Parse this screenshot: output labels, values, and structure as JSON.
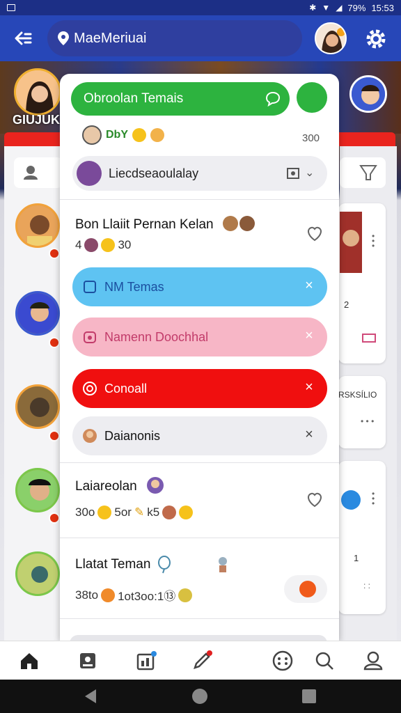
{
  "status_bar": {
    "battery": "79%",
    "time": "15:53"
  },
  "header": {
    "location": "MaeMeriuai",
    "icons": [
      "back-arrow-icon",
      "location-pin-icon",
      "gear-icon"
    ]
  },
  "background": {
    "corner_text": "GIUJUKI"
  },
  "panel": {
    "top_pill": "Obroolan Temais",
    "meta_label": "DbY",
    "meta_count": "300",
    "search_text": "Liecdseaoulalay",
    "items": [
      {
        "title": "Bon Llaiit Pernan Kelan",
        "sub_prefix": "4",
        "sub_suffix": "30"
      },
      {
        "title": "Laiareolan",
        "sub": "30o",
        "sub2": "5or",
        "sub3": "k5"
      },
      {
        "title": "Llatat Teman",
        "sub": "38to",
        "sub2": "1ot3oo:1⑬"
      }
    ],
    "bubbles": [
      {
        "label": "NM Temas",
        "style": "blue"
      },
      {
        "label": "Namenn Doochhal",
        "style": "pink"
      },
      {
        "label": "Conoall",
        "style": "red"
      },
      {
        "label": "Daianonis",
        "style": "grey"
      }
    ]
  },
  "right_cards": {
    "card1_count": "2",
    "card2_text": "RSKSÍLIO",
    "card3_count": "1"
  },
  "colors": {
    "header": "#2747b8",
    "accent_green": "#2db33f",
    "bubble_blue": "#5ec3f2",
    "bubble_pink": "#f7b6c6",
    "bubble_red": "#f00f0f"
  },
  "bottom_nav": [
    "home-icon",
    "contacts-icon",
    "calendar-icon",
    "pen-icon",
    "dots-grid-icon",
    "search-icon",
    "profile-icon"
  ]
}
